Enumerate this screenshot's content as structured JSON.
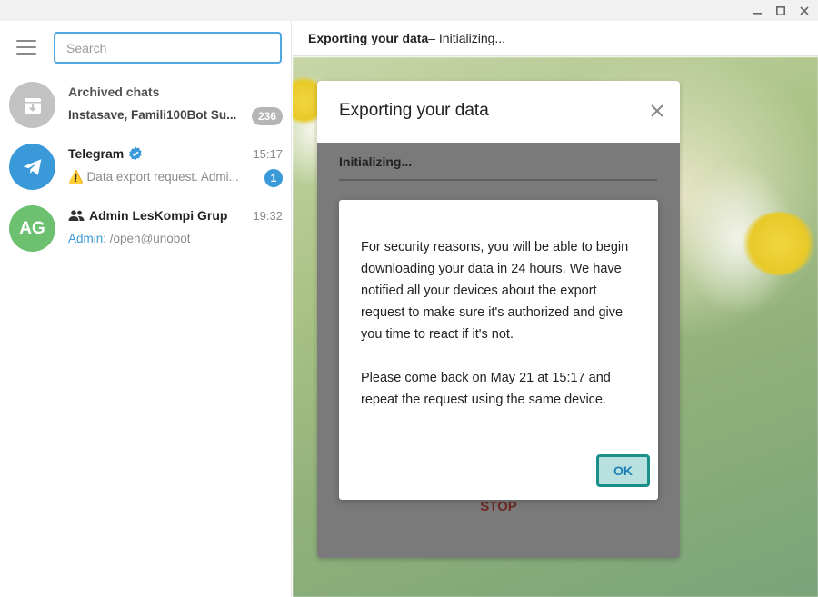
{
  "window": {
    "minimize_icon": "minimize-icon",
    "maximize_icon": "maximize-icon",
    "close_icon": "close-icon"
  },
  "sidebar": {
    "search": {
      "placeholder": "Search",
      "value": ""
    },
    "chats": [
      {
        "title": "Archived chats",
        "preview": "Instasave, Famili100Bot Su...",
        "badge": "236",
        "badge_color": "#b5b5b5",
        "avatar_color": "#c2c2c2",
        "icon": "archive-icon"
      },
      {
        "title": "Telegram",
        "verified": true,
        "time": "15:17",
        "preview": "⚠️ Data export request. Admi...",
        "badge": "1",
        "badge_color": "#3a9ad9",
        "avatar_color": "#3a9ad9",
        "icon": "telegram-plane-icon"
      },
      {
        "title": "Admin LesKompi Grup",
        "time": "19:32",
        "sender": "Admin:",
        "preview": " /open@unobot",
        "avatar_initials": "AG",
        "avatar_color": "#6cc070",
        "icon": "group-icon"
      }
    ]
  },
  "main": {
    "topbar": {
      "title_bold": "Exporting your data",
      "title_rest": " – Initializing..."
    }
  },
  "export_dialog": {
    "title": "Exporting your data",
    "status": "Initializing...",
    "progress": 0,
    "stop_label": "STOP"
  },
  "alert": {
    "paragraph1": "For security reasons, you will be able to begin downloading your data in 24 hours. We have notified all your devices about the export request to make sure it's authorized and give you time to react if it's not.",
    "paragraph2": "Please come back on May 21 at 15:17 and repeat the request using the same device.",
    "ok_label": "OK"
  },
  "colors": {
    "accent": "#3a9ad9",
    "ok_border": "#1a8f8a",
    "stop_text": "#6e2a22"
  }
}
